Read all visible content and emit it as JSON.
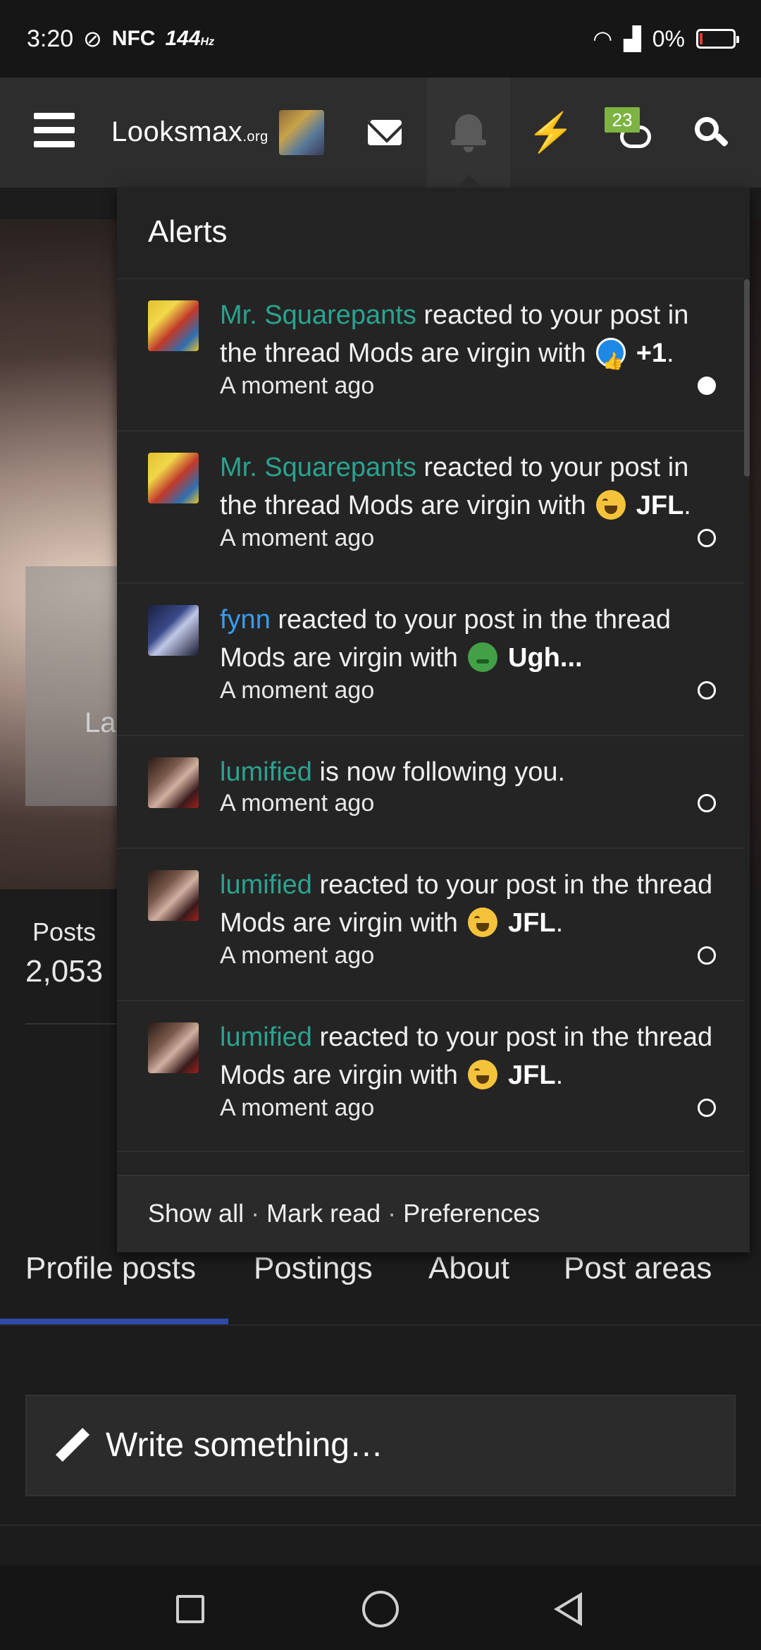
{
  "status_bar": {
    "time": "3:20",
    "nfc": "NFC",
    "refresh": "144",
    "refresh_unit": "Hz",
    "battery": "0%"
  },
  "header": {
    "logo_main": "Looksmax",
    "logo_suffix": ".org",
    "conversations_badge": "23",
    "icons": [
      "menu-icon",
      "mail-icon",
      "bell-icon",
      "bolt-icon",
      "conversations-icon",
      "search-icon"
    ]
  },
  "background_page": {
    "banner_text": "La",
    "stat_label": "Posts",
    "stat_value": "2,053",
    "tabs": [
      "Profile posts",
      "Postings",
      "About",
      "Post areas"
    ],
    "active_tab": "Profile posts",
    "write_placeholder": "Write something…"
  },
  "alerts": {
    "title": "Alerts",
    "items": [
      {
        "name": "Mr. Squarepants",
        "text": " reacted to your post in the thread Mods are virgin with ",
        "reaction": "+1",
        "reaction_icon": "thumbs-up-icon",
        "time": "A moment ago",
        "unread": true
      },
      {
        "name": "Mr. Squarepants",
        "text": " reacted to your post in the thread Mods are virgin with ",
        "reaction": "JFL",
        "reaction_icon": "laughing-crying-icon",
        "time": "A moment ago",
        "unread": false
      },
      {
        "name": "fynn",
        "text": " reacted to your post in the thread Mods are virgin with ",
        "reaction": "Ugh...",
        "reaction_icon": "nauseated-icon",
        "time": "A moment ago",
        "unread": false
      },
      {
        "name": "lumified",
        "text": " is now following you.",
        "reaction": "",
        "reaction_icon": "",
        "time": "A moment ago",
        "unread": false
      },
      {
        "name": "lumified",
        "text": " reacted to your post in the thread Mods are virgin with ",
        "reaction": "JFL",
        "reaction_icon": "laughing-crying-icon",
        "time": "A moment ago",
        "unread": false
      },
      {
        "name": "lumified",
        "text": " reacted to your post in the thread Mods are virgin with ",
        "reaction": "JFL",
        "reaction_icon": "laughing-crying-icon",
        "time": "A moment ago",
        "unread": false
      }
    ],
    "footer": {
      "show_all": "Show all",
      "mark_read": "Mark read",
      "preferences": "Preferences",
      "separator": " · "
    }
  },
  "colors": {
    "accent_name": "#2aa38f",
    "accent_name_alt": "#3a9bf0",
    "badge": "#7cb342",
    "active_tab_bar": "#2f4aa8"
  }
}
